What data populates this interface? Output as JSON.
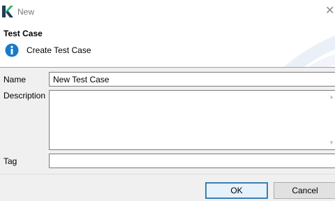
{
  "window": {
    "title": "New",
    "close_label": "✕"
  },
  "banner": {
    "title": "Test Case",
    "message": "Create Test Case"
  },
  "form": {
    "name_label": "Name",
    "name_value": "New Test Case",
    "description_label": "Description",
    "description_value": "",
    "tag_label": "Tag",
    "tag_value": ""
  },
  "buttons": {
    "ok_label": "OK",
    "cancel_label": "Cancel"
  },
  "colors": {
    "accent": "#3c7fb1",
    "info_icon": "#1a7ac8",
    "app_icon_green": "#2bb673",
    "app_icon_dark": "#1e3f5a"
  },
  "icons": {
    "app": "katalon-logo-icon",
    "info": "info-icon",
    "close": "close-icon"
  }
}
